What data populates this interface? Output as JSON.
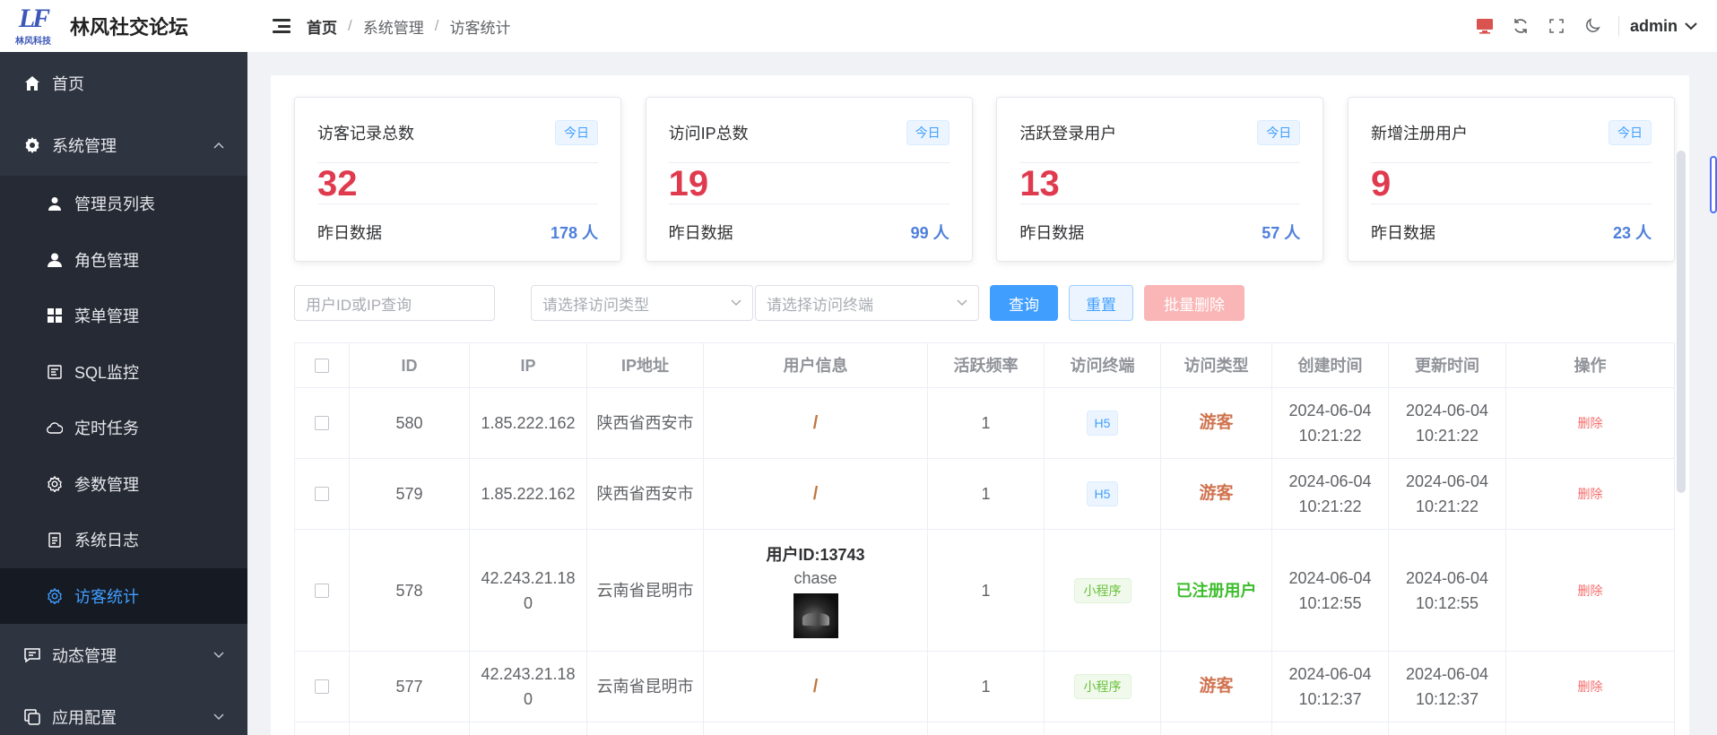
{
  "logo": {
    "mark": "LF",
    "company": "林风科技",
    "title": "林风社交论坛"
  },
  "breadcrumb": [
    "首页",
    "系统管理",
    "访客统计"
  ],
  "header": {
    "user": "admin"
  },
  "sidebar": {
    "items": [
      {
        "label": "首页",
        "icon": "home-icon"
      },
      {
        "label": "系统管理",
        "icon": "gear-icon",
        "expanded": true,
        "children": [
          {
            "label": "管理员列表",
            "icon": "user-icon"
          },
          {
            "label": "角色管理",
            "icon": "person-icon"
          },
          {
            "label": "菜单管理",
            "icon": "grid-icon"
          },
          {
            "label": "SQL监控",
            "icon": "monitor-icon"
          },
          {
            "label": "定时任务",
            "icon": "cloud-icon"
          },
          {
            "label": "参数管理",
            "icon": "cog-icon"
          },
          {
            "label": "系统日志",
            "icon": "document-icon"
          },
          {
            "label": "访客统计",
            "icon": "cog-icon",
            "active": true
          }
        ]
      },
      {
        "label": "动态管理",
        "icon": "chat-icon"
      },
      {
        "label": "应用配置",
        "icon": "copy-icon"
      }
    ]
  },
  "stats": [
    {
      "title": "访客记录总数",
      "tag": "今日",
      "value": "32",
      "footer_label": "昨日数据",
      "footer_value": "178 人"
    },
    {
      "title": "访问IP总数",
      "tag": "今日",
      "value": "19",
      "footer_label": "昨日数据",
      "footer_value": "99 人"
    },
    {
      "title": "活跃登录用户",
      "tag": "今日",
      "value": "13",
      "footer_label": "昨日数据",
      "footer_value": "57 人"
    },
    {
      "title": "新增注册用户",
      "tag": "今日",
      "value": "9",
      "footer_label": "昨日数据",
      "footer_value": "23 人"
    }
  ],
  "filters": {
    "search_placeholder": "用户ID或IP查询",
    "type_placeholder": "请选择访问类型",
    "terminal_placeholder": "请选择访问终端",
    "query_label": "查询",
    "reset_label": "重置",
    "batch_delete_label": "批量删除"
  },
  "table": {
    "columns": [
      "ID",
      "IP",
      "IP地址",
      "用户信息",
      "活跃频率",
      "访问终端",
      "访问类型",
      "创建时间",
      "更新时间",
      "操作"
    ],
    "rows": [
      {
        "id": "580",
        "ip": "1.85.222.162",
        "location": "陕西省西安市",
        "user": null,
        "freq": "1",
        "terminal": "H5",
        "type": "游客",
        "created": "2024-06-04 10:21:22",
        "updated": "2024-06-04 10:21:22",
        "action": "删除"
      },
      {
        "id": "579",
        "ip": "1.85.222.162",
        "location": "陕西省西安市",
        "user": null,
        "freq": "1",
        "terminal": "H5",
        "type": "游客",
        "created": "2024-06-04 10:21:22",
        "updated": "2024-06-04 10:21:22",
        "action": "删除"
      },
      {
        "id": "578",
        "ip": "42.243.21.180",
        "location": "云南省昆明市",
        "user": {
          "id_label": "用户ID:13743",
          "name": "chase"
        },
        "freq": "1",
        "terminal": "小程序",
        "type": "已注册用户",
        "created": "2024-06-04 10:12:55",
        "updated": "2024-06-04 10:12:55",
        "action": "删除"
      },
      {
        "id": "577",
        "ip": "42.243.21.180",
        "location": "云南省昆明市",
        "user": null,
        "freq": "1",
        "terminal": "小程序",
        "type": "游客",
        "created": "2024-06-04 10:12:37",
        "updated": "2024-06-04 10:12:37",
        "action": "删除"
      }
    ],
    "empty_user_mark": "/"
  },
  "colors": {
    "sidebar_bg": "#2f3441",
    "active_bg": "#161a22",
    "primary": "#409eff",
    "stat_number": "#e03a4e",
    "guest": "#d0734f",
    "registered": "#3dbd2c",
    "danger": "#f56c6c"
  }
}
